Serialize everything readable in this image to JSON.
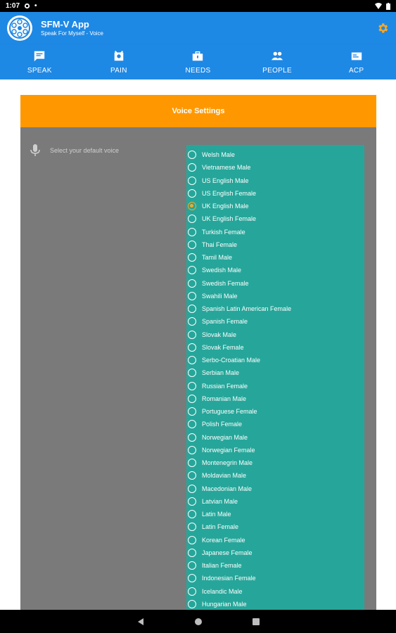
{
  "status_bar": {
    "time": "1:07"
  },
  "app_bar": {
    "title": "SFM-V App",
    "subtitle": "Speak For Myself - Voice"
  },
  "tabs": [
    {
      "label": "SPEAK",
      "icon": "chat-icon"
    },
    {
      "label": "PAIN",
      "icon": "pain-icon"
    },
    {
      "label": "NEEDS",
      "icon": "briefcase-icon"
    },
    {
      "label": "PEOPLE",
      "icon": "people-icon"
    },
    {
      "label": "ACP",
      "icon": "card-icon"
    }
  ],
  "voice_settings": {
    "title": "Voice Settings",
    "label": "Select your default voice",
    "selected": "UK English Male",
    "voices": [
      "Welsh Male",
      "Vietnamese Male",
      "US English Male",
      "US English Female",
      "UK English Male",
      "UK English Female",
      "Turkish Female",
      "Thai Female",
      "Tamil Male",
      "Swedish Male",
      "Swedish Female",
      "Swahili Male",
      "Spanish Latin American Female",
      "Spanish Female",
      "Slovak Male",
      "Slovak Female",
      "Serbo-Croatian Male",
      "Serbian Male",
      "Russian Female",
      "Romanian Male",
      "Portuguese Female",
      "Polish Female",
      "Norwegian Male",
      "Norwegian Female",
      "Montenegrin Male",
      "Moldavian Male",
      "Macedonian Male",
      "Latvian Male",
      "Latin Male",
      "Latin Female",
      "Korean Female",
      "Japanese Female",
      "Italian Female",
      "Indonesian Female",
      "Icelandic Male",
      "Hungarian Male"
    ]
  },
  "colors": {
    "primary": "#1e88e5",
    "header": "#ff9800",
    "list_bg": "#26a69a",
    "panel_bg": "#7a7a7a",
    "accent": "#f9a825"
  }
}
